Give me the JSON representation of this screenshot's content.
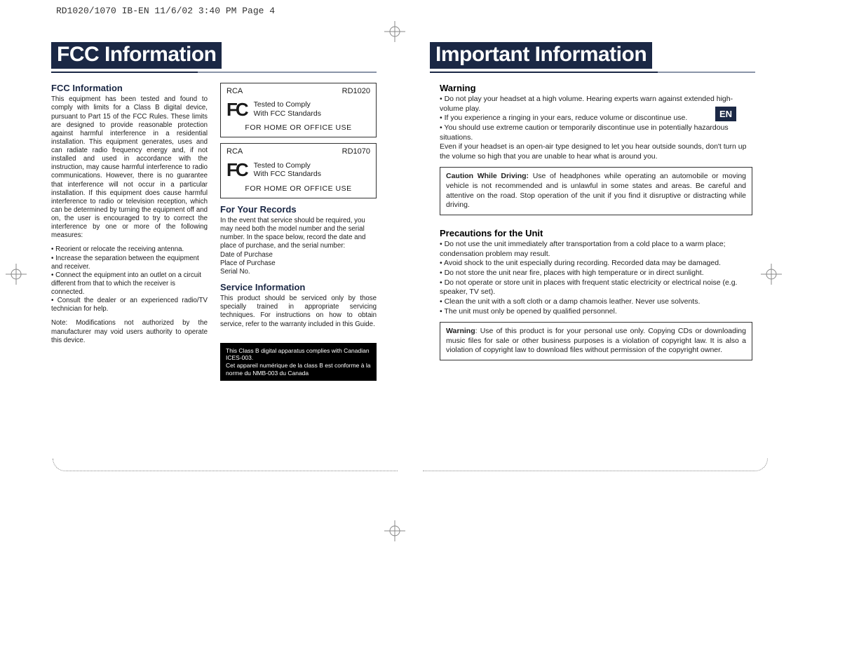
{
  "header": "RD1020/1070 IB-EN  11/6/02  3:40 PM  Page 4",
  "lang_tab": "EN",
  "left": {
    "title": "FCC Information",
    "fcc": {
      "heading": "FCC Information",
      "p1": "This equipment has been tested and found to comply with limits for a Class B digital device, pursuant to Part 15 of the FCC Rules.  These limits are designed to provide reasonable protection against harmful interference in a residential installation.  This equipment generates, uses and can radiate radio frequency energy and, if not installed and used in accordance with the instruction, may cause harmful interference to radio communications.  However, there is no guarantee that interference will not occur in a particular installation.  If this equipment does cause harmful interference to radio or television reception, which can be determined by turning the equipment off and on, the user is encouraged to try to correct the interference by one or more of the following measures:",
      "b1": "• Reorient or relocate the receiving antenna.",
      "b2": "• Increase the separation between the equipment and receiver.",
      "b3": "• Connect the equipment into an outlet on a circuit different from that to which the receiver is connected.",
      "b4": "• Consult the dealer or an experienced radio/TV technician for help.",
      "note": "Note: Modifications not authorized by the manufacturer may void users authority to operate this device."
    },
    "label1": {
      "brand": "RCA",
      "model": "RD1020",
      "tested1": "Tested to Comply",
      "tested2": "With FCC Standards",
      "use": "FOR HOME OR OFFICE USE"
    },
    "label2": {
      "brand": "RCA",
      "model": "RD1070",
      "tested1": "Tested to Comply",
      "tested2": "With FCC Standards",
      "use": "FOR HOME OR OFFICE USE"
    },
    "records": {
      "heading": "For Your Records",
      "p": "In the event that service should be required, you may need both the model number and the serial number.  In the space below, record the date and place of purchase, and the serial number:",
      "f1": "Date of Purchase",
      "f2": "Place of Purchase",
      "f3": "Serial No."
    },
    "service": {
      "heading": "Service Information",
      "p": "This product should be serviced only by those specially trained in appropriate servicing techniques. For instructions on how to obtain service, refer to the warranty included in this Guide."
    },
    "ices": {
      "en": "This Class B digital apparatus complies with Canadian ICES-003.",
      "fr": "Cet appareil numérique de la class B est conforme à la norme du NMB-003 du Canada"
    }
  },
  "right": {
    "title": "Important Information",
    "warning": {
      "heading": "Warning",
      "b1": "• Do not play your headset at a high volume.  Hearing experts warn against extended high-volume play.",
      "b2": "• If you experience a ringing in your ears, reduce volume or discontinue use.",
      "b3": "• You should use extreme caution or temporarily discontinue use in potentially hazardous situations.",
      "p4": "Even if your headset is an open-air type designed to let you hear outside sounds, don't turn up the volume so high that you are unable to hear what is around you."
    },
    "caution_box": {
      "lead": "Caution While Driving:  ",
      "text": "Use of headphones while operating an automobile or moving vehicle is not recommended and is unlawful in some states and areas. Be careful and attentive on the road. Stop operation of the unit if you find it disruptive or distracting while driving."
    },
    "precautions": {
      "heading": "Precautions for the Unit",
      "b1": "• Do not use the unit immediately after transportation from a cold place to a warm place; condensation problem may result.",
      "b2": "• Avoid shock to the unit especially during recording. Recorded data may be damaged.",
      "b3": "• Do not store the unit near fire, places with high temperature or in direct sunlight.",
      "b4": "• Do not operate or store unit in places with frequent static electricity or electrical noise (e.g. speaker, TV set).",
      "b5": "• Clean the unit with a soft cloth or a damp chamois leather. Never use solvents.",
      "b6": "• The unit must only be opened by qualified personnel."
    },
    "warning_box": {
      "lead": "Warning",
      "text": ":   Use of this product is for your personal use only. Copying CDs or downloading music files for sale or other business purposes is a violation of copyright law. It is also a violation of copyright law to download files without permission of the copyright owner."
    }
  }
}
